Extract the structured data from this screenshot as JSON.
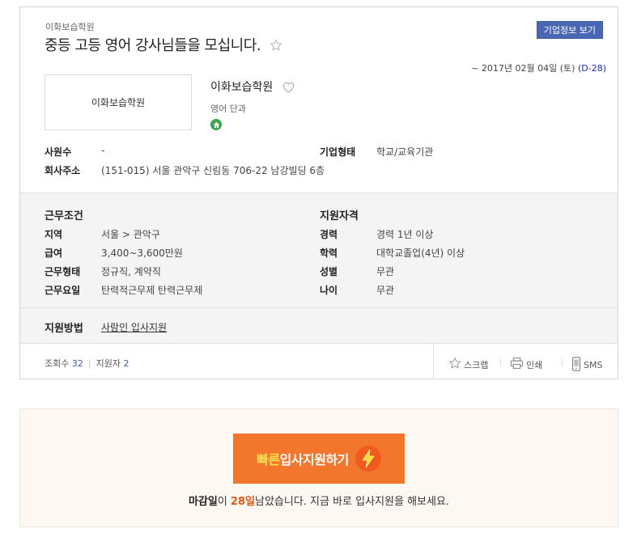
{
  "header": {
    "company_small": "이화보습학원",
    "job_title": "중등 고등 영어 강사님들을 모십니다.",
    "company_info_button": "기업정보 보기",
    "deadline_prefix": "~ 2017년 02월 04일 (토) ",
    "dday": "(D-28)"
  },
  "company": {
    "logo_text": "이화보습학원",
    "name": "이화보습학원",
    "industry": "영어 단과",
    "employees_label": "사원수",
    "employees_value": "-",
    "type_label": "기업형태",
    "type_value": "학교/교육기관",
    "address_label": "회사주소",
    "address_value": "(151-015) 서울 관악구 신림동 706-22 남강빌딩 6층"
  },
  "conditions": {
    "heading": "근무조건",
    "region_label": "지역",
    "region_value": "서울 > 관악구",
    "salary_label": "급여",
    "salary_value": "3,400~3,600만원",
    "employment_label": "근무형태",
    "employment_value": "정규직, 계약직",
    "days_label": "근무요일",
    "days_value": "탄력적근무제 탄력근무제"
  },
  "qualifications": {
    "heading": "지원자격",
    "career_label": "경력",
    "career_value": "경력 1년 이상",
    "education_label": "학력",
    "education_value": "대학교졸업(4년) 이상",
    "gender_label": "성별",
    "gender_value": "무관",
    "age_label": "나이",
    "age_value": "무관"
  },
  "apply_method": {
    "label": "지원방법",
    "link": "사람인 입사지원"
  },
  "stats": {
    "views_label": "조회수",
    "views": "32",
    "applicants_label": "지원자",
    "applicants": "2"
  },
  "actions": {
    "scrap": "스크랩",
    "print": "인쇄",
    "sms": "SMS"
  },
  "quick_apply": {
    "button_highlight": "빠른",
    "button_rest": "입사지원하기",
    "msg_label": "마감일",
    "msg_particle": "이 ",
    "days": "28일",
    "msg_rest": "남았습니다. 지금 바로 입사지원을 해보세요."
  },
  "colors": {
    "accent_blue": "#4a67b4",
    "dday_blue": "#1c26d0",
    "orange": "#f2772d",
    "highlight_yellow": "#ffe14d",
    "green_home": "#3aa84a"
  }
}
